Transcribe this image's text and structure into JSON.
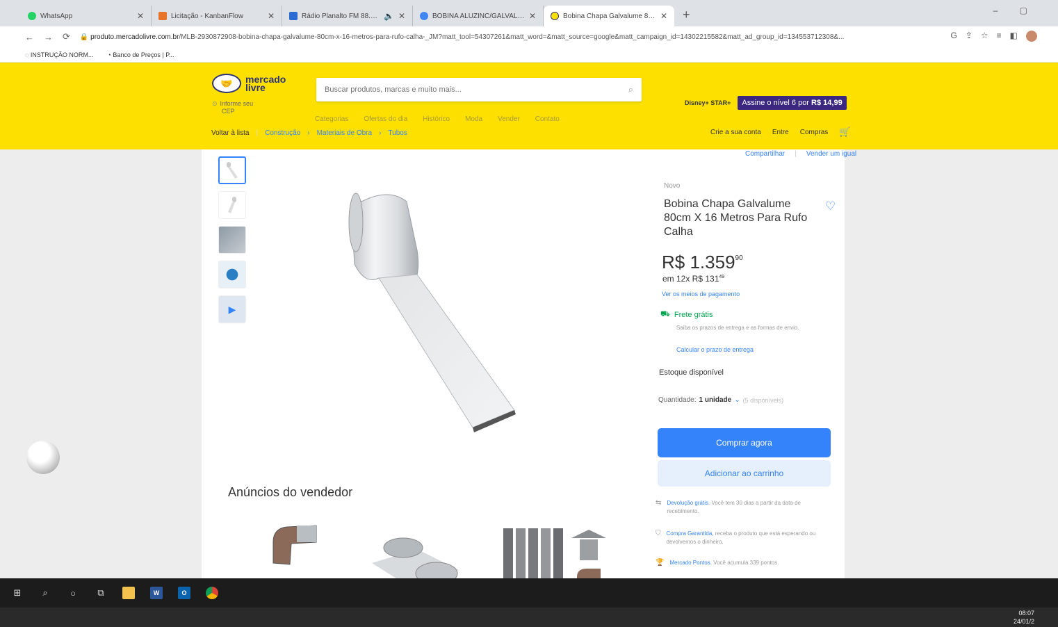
{
  "browser": {
    "tabs": [
      {
        "title": "WhatsApp",
        "color": "#25d366",
        "active": false
      },
      {
        "title": "Licitação - KanbanFlow",
        "color": "#e8732b",
        "active": false
      },
      {
        "title": "Rádio Planalto FM 88.3 - Pi",
        "color": "#2b6cd3",
        "active": false
      },
      {
        "title": "BOBINA ALUZINC/GALVALUME",
        "color": "#4285f4",
        "active": false
      },
      {
        "title": "Bobina Chapa Galvalume 80cm",
        "color": "#fee000",
        "active": true
      }
    ],
    "url_domain": "produto.mercadolivre.com.br",
    "url_path": "/MLB-2930872908-bobina-chapa-galvalume-80cm-x-16-metros-para-rufo-calha-_JM?matt_tool=54307261&matt_word=&matt_source=google&matt_campaign_id=14302215582&matt_ad_group_id=134553712308&...",
    "bookmarks": [
      "INSTRUÇÃO NORM...",
      "Banco de Preços | P..."
    ]
  },
  "header": {
    "logo_line1": "mercado",
    "logo_line2": "livre",
    "cep_line1": "Informe seu",
    "cep_line2": "CEP",
    "search_placeholder": "Buscar produtos, marcas e muito mais...",
    "nav": [
      "Categorias",
      "Ofertas do dia",
      "Histórico",
      "Moda",
      "Vender",
      "Contato"
    ],
    "promo_brand": "Disney+ STAR+",
    "promo_text": "Assine o nível 6 por",
    "promo_price": "R$ 14,99",
    "user_links": [
      "Crie a sua conta",
      "Entre",
      "Compras"
    ]
  },
  "breadcrumb": {
    "back": "Voltar à lista",
    "crumbs": [
      "Construção",
      "Materiais de Obra",
      "Tubos"
    ]
  },
  "share": {
    "share": "Compartilhar",
    "sell": "Vender um igual"
  },
  "product": {
    "condition": "Novo",
    "title": "Bobina Chapa Galvalume 80cm X 16 Metros Para Rufo Calha",
    "price_main": "R$ 1.359",
    "price_cents": "90",
    "installments": "em 12x R$ 131",
    "installments_cents": "49",
    "payment_link": "Ver os meios de pagamento",
    "shipping": "Frete grátis",
    "shipping_sub": "Saiba os prazos de entrega e as formas de envio.",
    "shipping_link": "Calcular o prazo de entrega",
    "stock": "Estoque disponível",
    "qty_label": "Quantidade:",
    "qty_value": "1 unidade",
    "qty_available": "(5 disponíveis)",
    "buy_now": "Comprar agora",
    "add_cart": "Adicionar ao carrinho",
    "benefits": [
      {
        "link": "Devolução grátis.",
        "text": "Você tem 30 dias a partir da data de recebimento."
      },
      {
        "link": "Compra Garantida,",
        "text": "receba o produto que está esperando ou devolvemos o dinheiro."
      },
      {
        "link": "Mercado Pontos.",
        "text": "Você acumula 339 pontos."
      }
    ]
  },
  "seller_ads_title": "Anúncios do vendedor",
  "taskbar": {
    "time": "08:07",
    "date": "24/01/2"
  },
  "colors": {
    "brand_yellow": "#fee000",
    "accent_blue": "#3483fa",
    "green": "#00a650"
  }
}
